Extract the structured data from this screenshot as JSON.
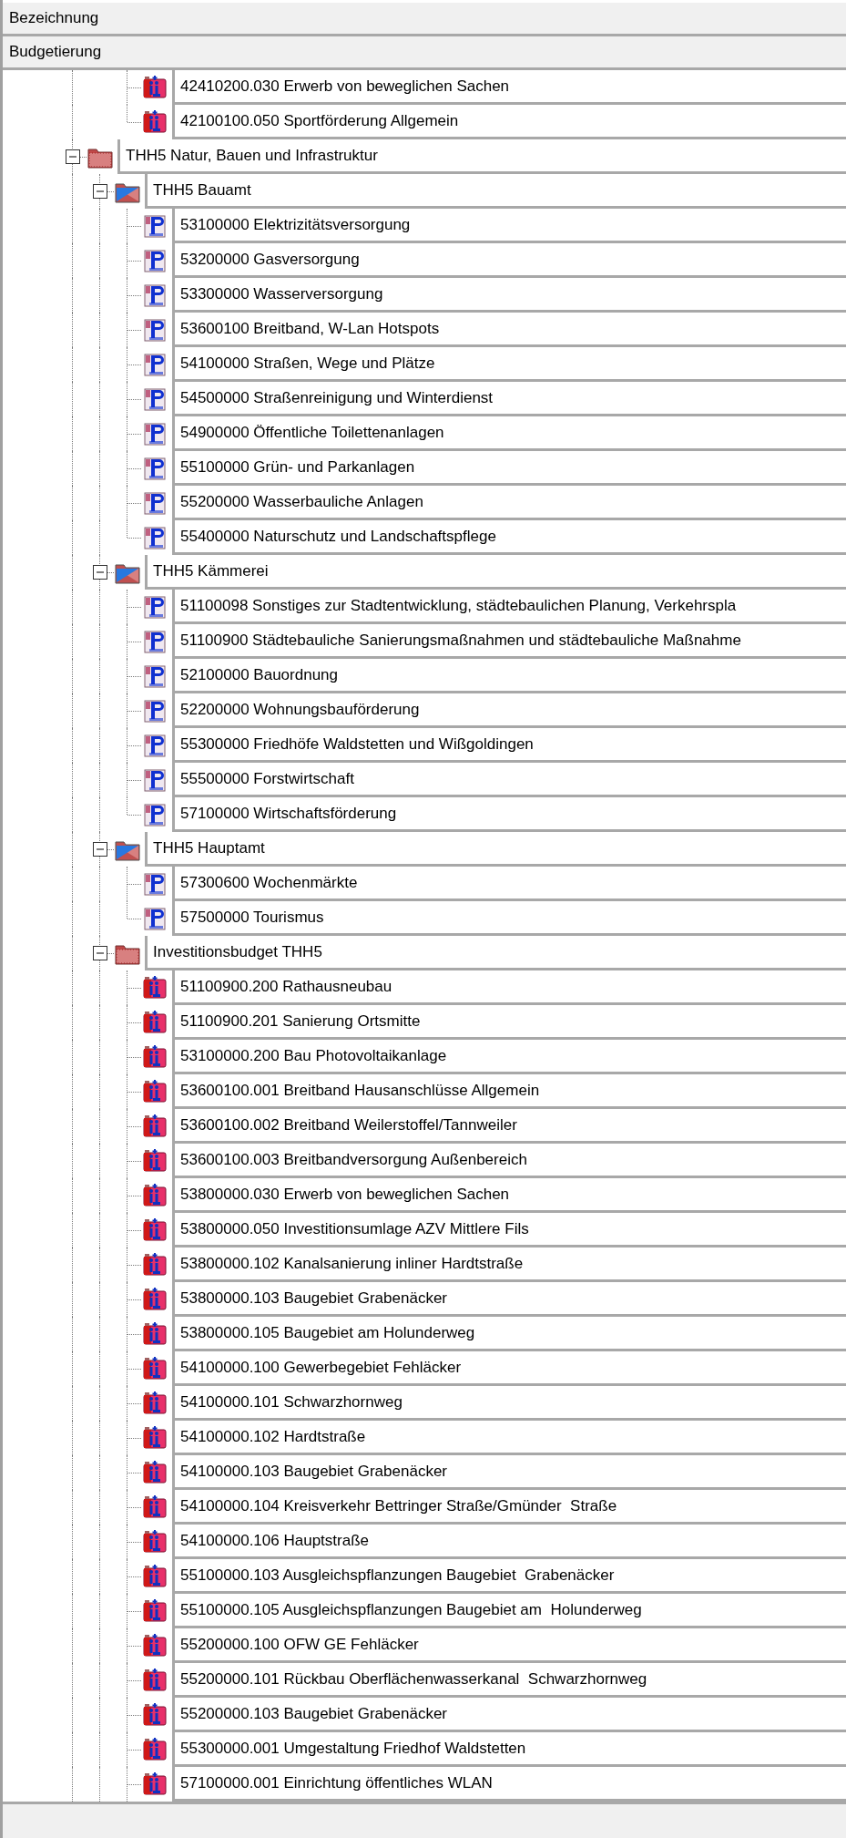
{
  "header_rows": [
    "Bezeichnung",
    "Budgetierung"
  ],
  "tree": [
    {
      "children": [
        {
          "children": [
            {
              "kind": "investment",
              "label": "42410200.030 Erwerb von beweglichen Sachen"
            },
            {
              "kind": "investment",
              "label": "42100100.050 Sportförderung Allgemein"
            }
          ]
        }
      ]
    },
    {
      "kind": "budget_folder",
      "label": "THH5 Natur, Bauen und Infrastruktur",
      "expanded": true,
      "children": [
        {
          "kind": "department_folder",
          "label": "THH5 Bauamt",
          "expanded": true,
          "children": [
            {
              "kind": "product",
              "label": "53100000 Elektrizitätsversorgung"
            },
            {
              "kind": "product",
              "label": "53200000 Gasversorgung"
            },
            {
              "kind": "product",
              "label": "53300000 Wasserversorgung"
            },
            {
              "kind": "product",
              "label": "53600100 Breitband, W-Lan Hotspots"
            },
            {
              "kind": "product",
              "label": "54100000 Straßen, Wege und Plätze"
            },
            {
              "kind": "product",
              "label": "54500000 Straßenreinigung und Winterdienst"
            },
            {
              "kind": "product",
              "label": "54900000 Öffentliche Toilettenanlagen"
            },
            {
              "kind": "product",
              "label": "55100000 Grün- und Parkanlagen"
            },
            {
              "kind": "product",
              "label": "55200000 Wasserbauliche Anlagen"
            },
            {
              "kind": "product",
              "label": "55400000 Naturschutz und Landschaftspflege"
            }
          ]
        },
        {
          "kind": "department_folder",
          "label": "THH5 Kämmerei",
          "expanded": true,
          "children": [
            {
              "kind": "product",
              "label": "51100098 Sonstiges zur Stadtentwicklung, städtebaulichen Planung, Verkehrspla"
            },
            {
              "kind": "product",
              "label": "51100900 Städtebauliche Sanierungsmaßnahmen und städtebauliche Maßnahme"
            },
            {
              "kind": "product",
              "label": "52100000 Bauordnung"
            },
            {
              "kind": "product",
              "label": "52200000 Wohnungsbauförderung"
            },
            {
              "kind": "product",
              "label": "55300000 Friedhöfe Waldstetten und Wißgoldingen"
            },
            {
              "kind": "product",
              "label": "55500000 Forstwirtschaft"
            },
            {
              "kind": "product",
              "label": "57100000 Wirtschaftsförderung"
            }
          ]
        },
        {
          "kind": "department_folder",
          "label": "THH5 Hauptamt",
          "expanded": true,
          "children": [
            {
              "kind": "product",
              "label": "57300600 Wochenmärkte"
            },
            {
              "kind": "product",
              "label": "57500000 Tourismus"
            }
          ]
        },
        {
          "kind": "budget_folder",
          "label": "Investitionsbudget THH5",
          "expanded": true,
          "children": [
            {
              "kind": "investment",
              "label": "51100900.200 Rathausneubau"
            },
            {
              "kind": "investment",
              "label": "51100900.201 Sanierung Ortsmitte"
            },
            {
              "kind": "investment",
              "label": "53100000.200 Bau Photovoltaikanlage"
            },
            {
              "kind": "investment",
              "label": "53600100.001 Breitband Hausanschlüsse Allgemein"
            },
            {
              "kind": "investment",
              "label": "53600100.002 Breitband Weilerstoffel/Tannweiler"
            },
            {
              "kind": "investment",
              "label": "53600100.003 Breitbandversorgung Außenbereich"
            },
            {
              "kind": "investment",
              "label": "53800000.030 Erwerb von beweglichen Sachen"
            },
            {
              "kind": "investment",
              "label": "53800000.050 Investitionsumlage AZV Mittlere Fils"
            },
            {
              "kind": "investment",
              "label": "53800000.102 Kanalsanierung inliner Hardtstraße"
            },
            {
              "kind": "investment",
              "label": "53800000.103 Baugebiet Grabenäcker"
            },
            {
              "kind": "investment",
              "label": "53800000.105 Baugebiet am Holunderweg"
            },
            {
              "kind": "investment",
              "label": "54100000.100 Gewerbegebiet Fehläcker"
            },
            {
              "kind": "investment",
              "label": "54100000.101 Schwarzhornweg"
            },
            {
              "kind": "investment",
              "label": "54100000.102 Hardtstraße"
            },
            {
              "kind": "investment",
              "label": "54100000.103 Baugebiet Grabenäcker"
            },
            {
              "kind": "investment",
              "label": "54100000.104 Kreisverkehr Bettringer Straße/Gmünder  Straße"
            },
            {
              "kind": "investment",
              "label": "54100000.106 Hauptstraße"
            },
            {
              "kind": "investment",
              "label": "55100000.103 Ausgleichspflanzungen Baugebiet  Grabenäcker"
            },
            {
              "kind": "investment",
              "label": "55100000.105 Ausgleichspflanzungen Baugebiet am  Holunderweg"
            },
            {
              "kind": "investment",
              "label": "55200000.100 OFW GE Fehläcker"
            },
            {
              "kind": "investment",
              "label": "55200000.101 Rückbau Oberflächenwasserkanal  Schwarzhornweg"
            },
            {
              "kind": "investment",
              "label": "55200000.103 Baugebiet Grabenäcker"
            },
            {
              "kind": "investment",
              "label": "55300000.001 Umgestaltung Friedhof Waldstetten"
            },
            {
              "kind": "investment",
              "label": "57100000.001 Einrichtung öffentliches WLAN"
            }
          ]
        }
      ]
    }
  ]
}
